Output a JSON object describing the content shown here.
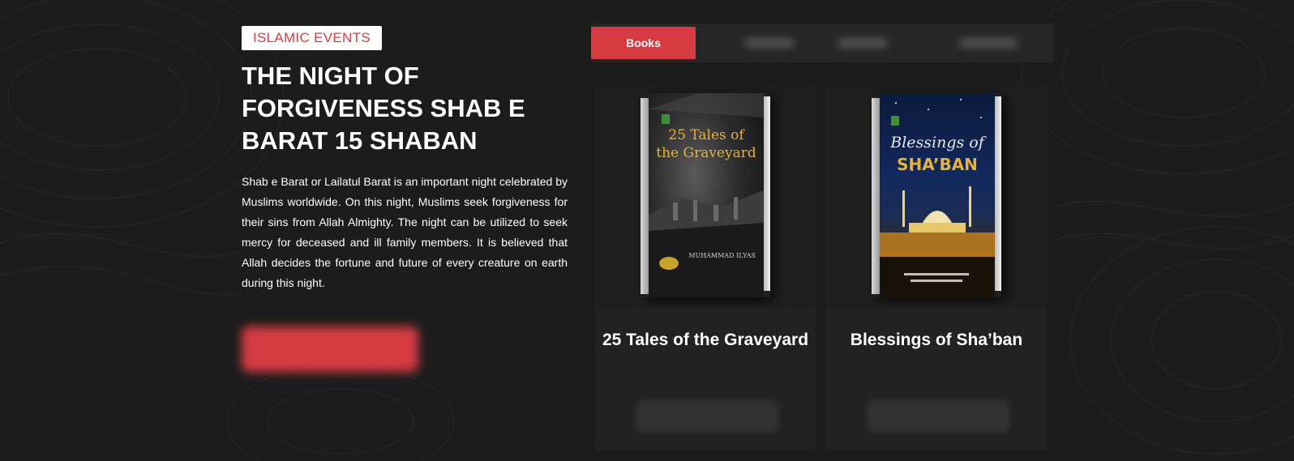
{
  "hero": {
    "category": "ISLAMIC EVENTS",
    "title": "THE NIGHT OF FORGIVENESS SHAB E BARAT 15 SHABAN",
    "description": "Shab e Barat or Lailatul Barat is an important night celebrated by Muslims worldwide. On this night, Muslims seek forgiveness for their sins from Allah Almighty. The night can be utilized to seek mercy for deceased and ill family members. It is believed that Allah decides the fortune and future of every creature on earth during this night."
  },
  "tabs": {
    "active_label": "Books"
  },
  "books": [
    {
      "title": "25 Tales of the Graveyard",
      "cover_line1": "25 Tales of",
      "cover_line2": "the Graveyard",
      "cover_author": "Muhammad Ilyas"
    },
    {
      "title": "Blessings of Sha’ban",
      "cover_line1": "Blessings of",
      "cover_line2": "SHA’BAN"
    }
  ],
  "colors": {
    "accent": "#d63b42",
    "background": "#1c1c1c",
    "card": "#222222",
    "cover_gold": "#e6b23a"
  }
}
